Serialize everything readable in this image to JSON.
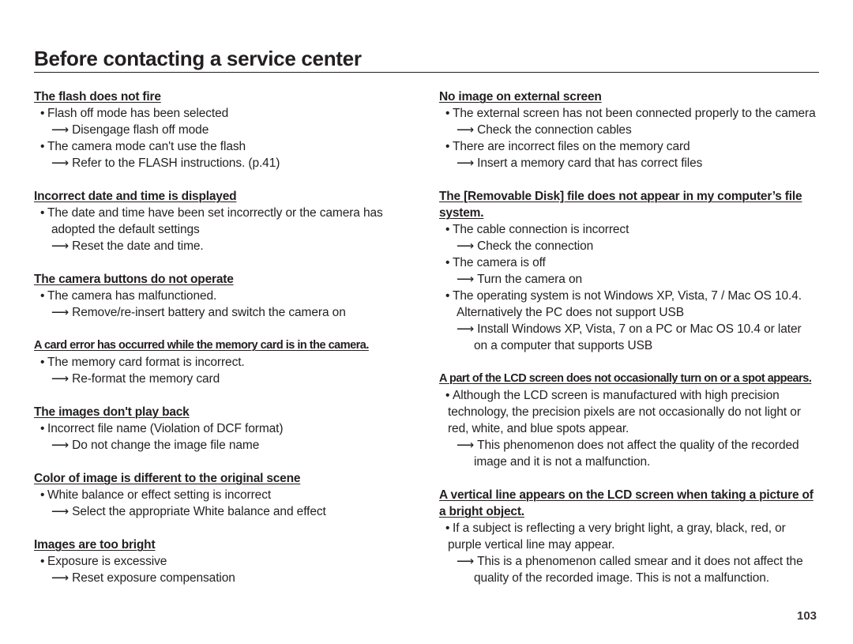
{
  "page": {
    "title": "Before contacting a service center",
    "page_number": "103"
  },
  "icons": {
    "bullet": "•",
    "arrow": "⟶"
  },
  "left_column": [
    {
      "heading": "The flash does not fire",
      "lines": [
        {
          "type": "bullet",
          "text": "Flash off mode has been selected"
        },
        {
          "type": "arrow",
          "text": "Disengage flash off mode"
        },
        {
          "type": "bullet",
          "text": "The camera mode can't use the flash"
        },
        {
          "type": "arrow",
          "text": "Refer to the FLASH instructions. (p.41)"
        }
      ]
    },
    {
      "heading": "Incorrect date and time is displayed",
      "lines": [
        {
          "type": "bullet",
          "text": "The date and time have been set incorrectly or the camera has"
        },
        {
          "type": "cont",
          "text": "adopted the default settings"
        },
        {
          "type": "arrow",
          "text": "Reset the date and time."
        }
      ]
    },
    {
      "heading": "The camera buttons do not operate",
      "lines": [
        {
          "type": "bullet",
          "text": "The camera has malfunctioned."
        },
        {
          "type": "arrow",
          "text": "Remove/re-insert battery and switch the camera on"
        }
      ]
    },
    {
      "heading": "A card error has occurred while the memory card is in the camera.",
      "lines": [
        {
          "type": "bullet",
          "text": "The memory card format is incorrect."
        },
        {
          "type": "arrow",
          "text": "Re-format the memory card"
        }
      ]
    },
    {
      "heading": "The images don't play back",
      "lines": [
        {
          "type": "bullet",
          "text": "Incorrect file name (Violation of DCF format)"
        },
        {
          "type": "arrow",
          "text": "Do not change the image file name"
        }
      ]
    },
    {
      "heading": "Color of image is different to the original scene",
      "lines": [
        {
          "type": "bullet",
          "text": "White balance or effect setting is incorrect"
        },
        {
          "type": "arrow",
          "text": "Select the appropriate White balance and effect"
        }
      ]
    },
    {
      "heading": "Images are too bright",
      "lines": [
        {
          "type": "bullet",
          "text": "Exposure is excessive"
        },
        {
          "type": "arrow",
          "text": "Reset exposure compensation"
        }
      ]
    }
  ],
  "right_column": [
    {
      "heading": "No image on external screen",
      "lines": [
        {
          "type": "bullet",
          "text": "The external screen has not been connected properly to the camera"
        },
        {
          "type": "arrow",
          "text": "Check the connection cables"
        },
        {
          "type": "bullet",
          "text": "There are incorrect files on the memory card"
        },
        {
          "type": "arrow",
          "text": "Insert a memory card that has correct files"
        }
      ]
    },
    {
      "heading": "The [Removable Disk] file does not appear in my computer’s file system.",
      "lines": [
        {
          "type": "bullet",
          "text": "The cable connection is incorrect"
        },
        {
          "type": "arrow",
          "text": "Check the connection"
        },
        {
          "type": "bullet",
          "text": "The camera is off"
        },
        {
          "type": "arrow",
          "text": "Turn the camera on"
        },
        {
          "type": "bullet",
          "text": "The operating system is not Windows XP, Vista, 7 / Mac OS 10.4."
        },
        {
          "type": "cont",
          "text": "Alternatively the PC does not support USB"
        },
        {
          "type": "arrow",
          "text": "Install Windows XP, Vista, 7 on a PC or Mac OS 10.4 or later"
        },
        {
          "type": "arrow-cont",
          "text": "on a computer that supports USB"
        }
      ]
    },
    {
      "heading": "A part of the LCD screen does not occasionally turn on or a spot appears.",
      "lines": [
        {
          "type": "bullet",
          "text": "Although the LCD screen is manufactured with high precision"
        },
        {
          "type": "cont2",
          "text": "technology, the precision pixels are not occasionally do not light or"
        },
        {
          "type": "cont2",
          "text": "red, white, and blue spots appear."
        },
        {
          "type": "arrow",
          "text": "This phenomenon does not affect the quality of the recorded"
        },
        {
          "type": "arrow-cont",
          "text": "image and it is not a malfunction."
        }
      ]
    },
    {
      "heading": "A vertical line appears on the LCD screen when taking a picture of a bright object.",
      "lines": [
        {
          "type": "bullet",
          "text": "If a subject is reflecting a very bright light, a gray, black, red, or"
        },
        {
          "type": "cont2",
          "text": "purple vertical line may appear."
        },
        {
          "type": "arrow",
          "text": "This is a phenomenon called smear and it does not affect the"
        },
        {
          "type": "arrow-cont",
          "text": "quality of the recorded image. This is not a malfunction."
        }
      ]
    }
  ]
}
